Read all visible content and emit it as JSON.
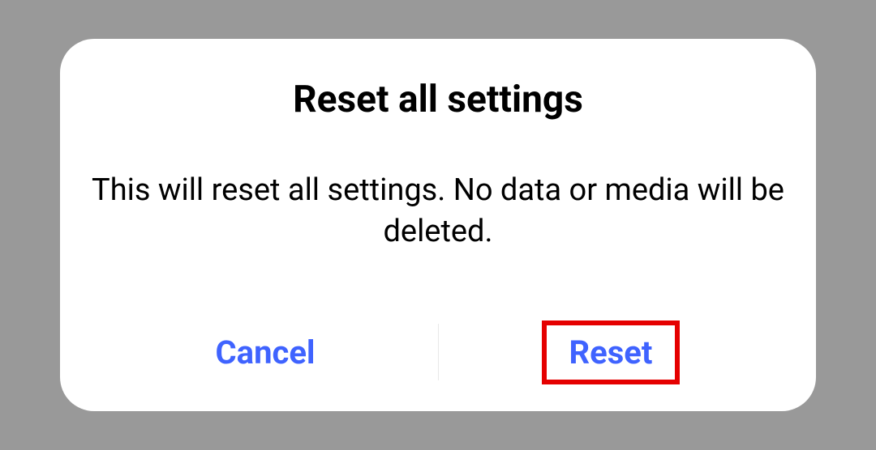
{
  "dialog": {
    "title": "Reset all settings",
    "body": "This will reset all settings. No data or media will be deleted.",
    "cancel_label": "Cancel",
    "confirm_label": "Reset"
  }
}
